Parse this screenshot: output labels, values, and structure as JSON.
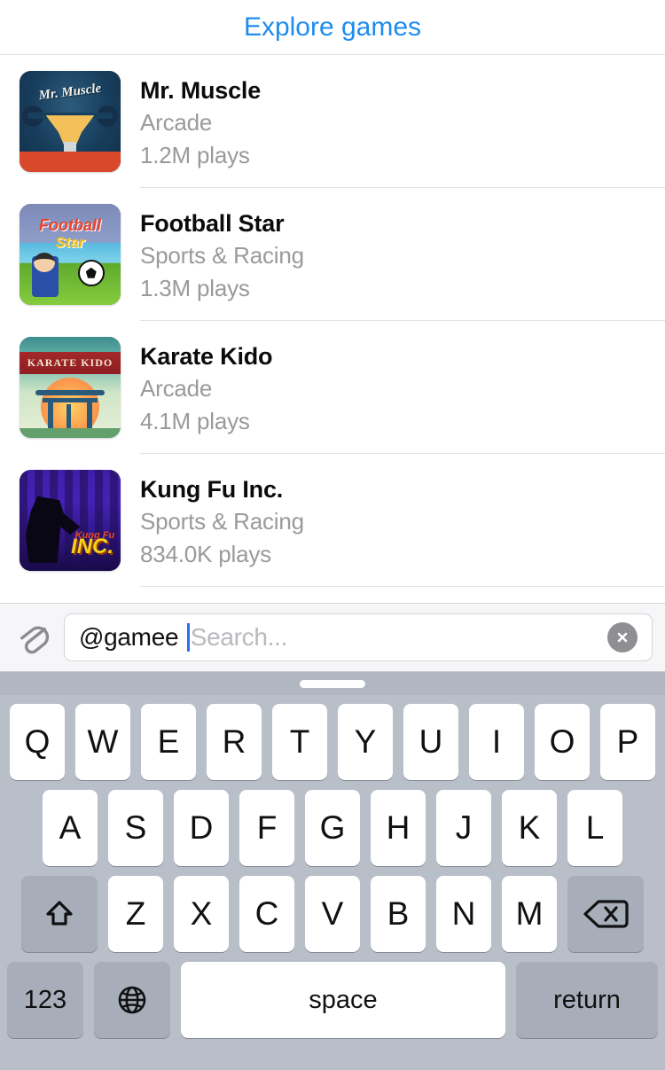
{
  "header": {
    "title": "Explore games"
  },
  "games": [
    {
      "title": "Mr. Muscle",
      "category": "Arcade",
      "plays": "1.2M plays",
      "art": "muscle",
      "thumb_title": "Mr. Muscle"
    },
    {
      "title": "Football Star",
      "category": "Sports & Racing",
      "plays": "1.3M plays",
      "art": "football",
      "thumb_title1": "Football",
      "thumb_title2": "Star"
    },
    {
      "title": "Karate Kido",
      "category": "Arcade",
      "plays": "4.1M plays",
      "art": "karate",
      "thumb_title": "KARATE KIDO"
    },
    {
      "title": "Kung Fu Inc.",
      "category": "Sports & Racing",
      "plays": "834.0K plays",
      "art": "kungfu",
      "thumb_title1": "Kung Fu",
      "thumb_title2": "INC."
    }
  ],
  "input_bar": {
    "attach_icon": "paperclip-icon",
    "typed_value": "@gamee ",
    "placeholder": "Search...",
    "clear_icon": "clear-circle-icon"
  },
  "keyboard": {
    "row1": [
      "Q",
      "W",
      "E",
      "R",
      "T",
      "Y",
      "U",
      "I",
      "O",
      "P"
    ],
    "row2": [
      "A",
      "S",
      "D",
      "F",
      "G",
      "H",
      "J",
      "K",
      "L"
    ],
    "row3": [
      "Z",
      "X",
      "C",
      "V",
      "B",
      "N",
      "M"
    ],
    "shift_icon": "shift-arrow-icon",
    "backspace_icon": "backspace-icon",
    "numeric_label": "123",
    "globe_icon": "globe-icon",
    "space_label": "space",
    "return_label": "return"
  },
  "colors": {
    "accent": "#1f8ced",
    "keyboard_bg": "#b9bfc8",
    "key_bg": "#ffffff",
    "ctrl_key_bg": "#a7aeb9",
    "secondary_text": "#9a9a9e",
    "caret": "#2b6cf6"
  }
}
